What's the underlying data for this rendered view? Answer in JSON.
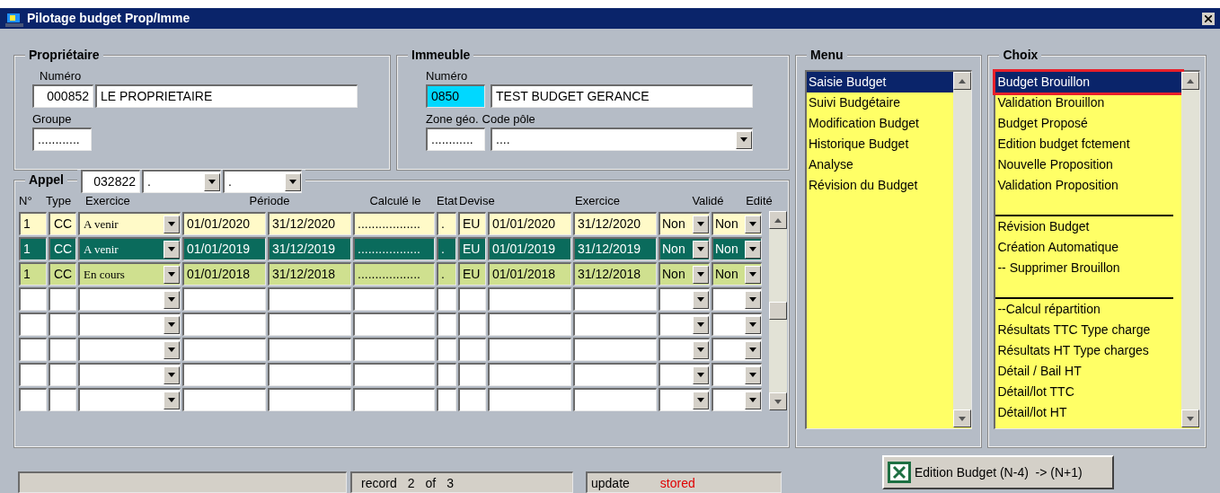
{
  "window": {
    "title": "Pilotage budget Prop/Imme"
  },
  "proprietaire": {
    "legend": "Propriétaire",
    "numero_label": "Numéro",
    "numero": "000852",
    "nom": "LE PROPRIETAIRE",
    "groupe_label": "Groupe",
    "groupe": "............"
  },
  "immeuble": {
    "legend": "Immeuble",
    "numero_label": "Numéro",
    "numero": "0850",
    "nom": "TEST BUDGET GERANCE",
    "zone_label": "Zone géo.",
    "zone": "............",
    "pole_label": "Code pôle",
    "pole": "...."
  },
  "appel": {
    "legend": "Appel",
    "code": "032822",
    "select_1": ".",
    "select_2": ".",
    "columns": [
      "N°",
      "Type",
      "Exercice",
      "Période",
      "Calculé le",
      "Etat",
      "Devise",
      "Exercice",
      "Validé",
      "Edité"
    ],
    "rows": [
      {
        "num": "1",
        "type": "CC",
        "exercice": "A venir",
        "debut": "01/01/2020",
        "fin": "31/12/2020",
        "calcule": "..................",
        "etat": ".",
        "devise": "EU",
        "ex_debut": "01/01/2020",
        "ex_fin": "31/12/2020",
        "valide": "Non",
        "edite": "Non",
        "color": "#fffac8",
        "selected": false
      },
      {
        "num": "1",
        "type": "CC",
        "exercice": "A venir",
        "debut": "01/01/2019",
        "fin": "31/12/2019",
        "calcule": "..................",
        "etat": ".",
        "devise": "EU",
        "ex_debut": "01/01/2019",
        "ex_fin": "31/12/2019",
        "valide": "Non",
        "edite": "Non",
        "color": "#0a6b5c",
        "selected": true
      },
      {
        "num": "1",
        "type": "CC",
        "exercice": "En cours",
        "debut": "01/01/2018",
        "fin": "31/12/2018",
        "calcule": "..................",
        "etat": ".",
        "devise": "EU",
        "ex_debut": "01/01/2018",
        "ex_fin": "31/12/2018",
        "valide": "Non",
        "edite": "Non",
        "color": "#cfe08f",
        "selected": false
      }
    ]
  },
  "menu": {
    "legend": "Menu",
    "items": [
      {
        "label": "Saisie Budget",
        "selected": true
      },
      {
        "label": "Suivi Budgétaire",
        "selected": false
      },
      {
        "label": "Modification Budget",
        "selected": false
      },
      {
        "label": "Historique Budget",
        "selected": false
      },
      {
        "label": "Analyse",
        "selected": false
      },
      {
        "label": "Révision du Budget",
        "selected": false
      }
    ]
  },
  "choix": {
    "legend": "Choix",
    "items": [
      {
        "kind": "item",
        "label": "Budget Brouillon",
        "selected": true,
        "highlighted": true
      },
      {
        "kind": "item",
        "label": "Validation Brouillon",
        "selected": false,
        "highlighted": false
      },
      {
        "kind": "item",
        "label": "Budget Proposé",
        "selected": false,
        "highlighted": false
      },
      {
        "kind": "item",
        "label": "Edition budget fctement",
        "selected": false,
        "highlighted": false
      },
      {
        "kind": "item",
        "label": "Nouvelle Proposition",
        "selected": false,
        "highlighted": false
      },
      {
        "kind": "item",
        "label": "Validation Proposition",
        "selected": false,
        "highlighted": false
      },
      {
        "kind": "separator"
      },
      {
        "kind": "item",
        "label": "Révision Budget",
        "selected": false,
        "highlighted": false
      },
      {
        "kind": "item",
        "label": "Création Automatique",
        "selected": false,
        "highlighted": false
      },
      {
        "kind": "item",
        "label": "-- Supprimer Brouillon",
        "selected": false,
        "highlighted": false
      },
      {
        "kind": "separator"
      },
      {
        "kind": "item",
        "label": "--Calcul répartition",
        "selected": false,
        "highlighted": false
      },
      {
        "kind": "item",
        "label": "Résultats TTC Type charge",
        "selected": false,
        "highlighted": false
      },
      {
        "kind": "item",
        "label": "Résultats HT Type charges",
        "selected": false,
        "highlighted": false
      },
      {
        "kind": "item",
        "label": "Détail / Bail HT",
        "selected": false,
        "highlighted": false
      },
      {
        "kind": "item",
        "label": "Détail/lot TTC",
        "selected": false,
        "highlighted": false
      },
      {
        "kind": "item",
        "label": "Détail/lot HT",
        "selected": false,
        "highlighted": false
      }
    ]
  },
  "status_bar": {
    "record_label": "record",
    "record": "2",
    "of_label": "of",
    "total": "3",
    "update_label": "update",
    "update_status": "stored"
  },
  "edition_button": {
    "label": "Edition Budget (N-4)  -> (N+1)"
  }
}
